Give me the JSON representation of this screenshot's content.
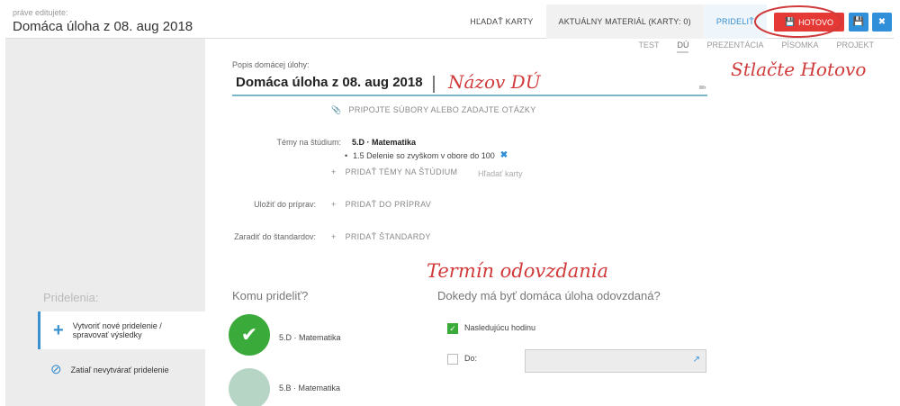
{
  "header": {
    "editing_hint": "práve editujete:",
    "title": "Domáca úloha z 08. aug 2018",
    "nav": {
      "search_cards": "HĽADAŤ KARTY",
      "current_material": "AKTUÁLNY MATERIÁL (KARTY: 0)",
      "assign": "PRIDELIŤ",
      "done": "HOTOVO"
    },
    "icons": {
      "done": "save-icon",
      "save": "save-icon",
      "close": "close-icon"
    }
  },
  "type_tabs": [
    "TEST",
    "DÚ",
    "PREZENTÁCIA",
    "PÍSOMKA",
    "PROJEKT"
  ],
  "active_type_tab": "DÚ",
  "form": {
    "description_label": "Popis domácej úlohy:",
    "description_value": "Domáca úloha z 08. aug 2018",
    "attach_link": "PRIPOJTE SÚBORY ALEBO ZADAJTE OTÁZKY",
    "topics_label": "Témy na štúdium:",
    "topic_class": "5.D · Matematika",
    "topic_item": "1.5 Delenie so zvyškom v obore do 100",
    "add_topics": "PRIDAŤ TÉMY NA ŠTÚDIUM",
    "search_cards": "Hľadať karty",
    "save_to_label": "Uložiť do príprav:",
    "add_to_preps": "PRIDAŤ DO PRÍPRAV",
    "standards_label": "Zaradiť do štandardov:",
    "add_standards": "PRIDAŤ ŠTANDARDY"
  },
  "annotations": {
    "name_hint": "Názov DÚ",
    "press_done": "Stlačte Hotovo",
    "deadline": "Termín odovzdania"
  },
  "sidebar": {
    "heading": "Pridelenia:",
    "create": "Vytvoriť nové pridelenie / spravovať výsledky",
    "none": "Zatiaľ nevytvárať pridelenie"
  },
  "assign": {
    "to_whom": "Komu prideliť?",
    "classes": [
      {
        "name": "5.D · Matematika",
        "selected": true
      },
      {
        "name": "5.B · Matematika",
        "selected": false
      }
    ],
    "deadline_q": "Dokedy má byť domáca úloha odovzdaná?",
    "next_lesson": "Nasledujúcu hodinu",
    "next_lesson_checked": true,
    "until": "Do:",
    "until_checked": false,
    "until_value": ""
  },
  "colors": {
    "accent": "#3a8fcf",
    "done_button": "#e53935",
    "annotation": "#d13a3a",
    "check": "#3aaa3a"
  }
}
